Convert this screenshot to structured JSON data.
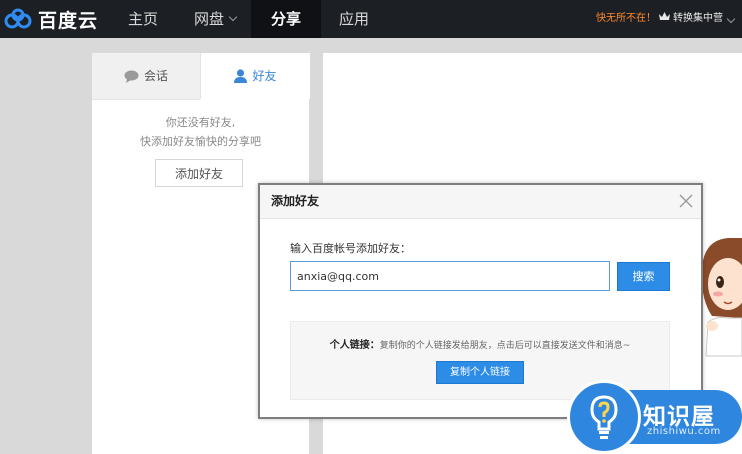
{
  "app": {
    "logo_text": "百度云"
  },
  "nav": {
    "home": "主页",
    "disk": "网盘",
    "share": "分享",
    "apps": "应用"
  },
  "header": {
    "promo": "快无所不在！",
    "switch": "转换集中营"
  },
  "friends_panel": {
    "tabs": {
      "chat": "会话",
      "friends": "好友"
    },
    "empty_line1": "你还没有好友,",
    "empty_line2": "快添加好友愉快的分享吧",
    "add_button": "添加好友"
  },
  "dialog": {
    "title": "添加好友",
    "input_label": "输入百度帐号添加好友：",
    "input_value": "anxia@qq.com",
    "search_button": "搜索",
    "personal_link_label": "个人链接：",
    "personal_link_desc": "复制你的个人链接发给朋友，点击后可以直接发送文件和消息~",
    "copy_button": "复制个人链接"
  },
  "watermark": {
    "title": "知识屋",
    "subtitle": "zhishiwu.com"
  },
  "colors": {
    "topbar": "#1c1f24",
    "accent": "#2d8ce6",
    "promo": "#ff8a2a"
  }
}
